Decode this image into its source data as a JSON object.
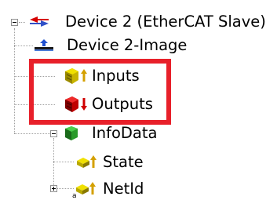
{
  "tree": {
    "device": {
      "label": "Device 2 (EtherCAT Slave)",
      "icon": "ethercat-slave-icon",
      "expanded": true
    },
    "children": [
      {
        "label": "Device 2-Image",
        "icon": "process-image-icon"
      },
      {
        "label": "Inputs",
        "icon": "inputs-icon"
      },
      {
        "label": "Outputs",
        "icon": "outputs-icon"
      },
      {
        "label": "InfoData",
        "icon": "infodata-icon",
        "expanded": true,
        "children": [
          {
            "label": "State",
            "icon": "state-variable-icon"
          },
          {
            "label": "NetId",
            "icon": "netid-variable-icon",
            "expanded": false
          }
        ]
      }
    ]
  },
  "highlight": {
    "color": "#e8202a",
    "covers": [
      "Inputs",
      "Outputs"
    ]
  },
  "colors": {
    "input_arrow": "#d4a000",
    "output_arrow": "#d00000",
    "tree_lines": "#a0a0a0"
  }
}
